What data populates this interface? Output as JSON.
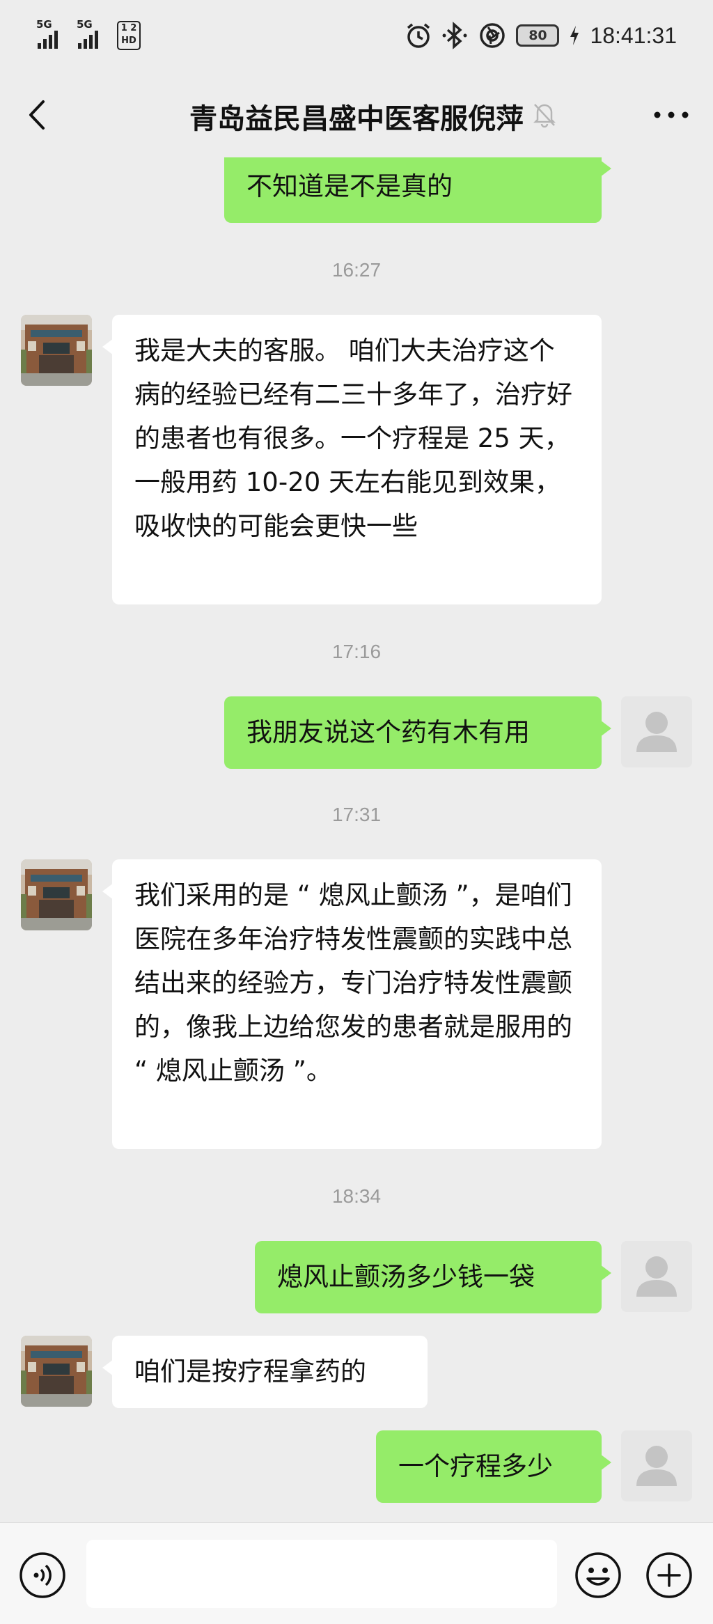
{
  "status_bar": {
    "sim1_label": "5G",
    "sim2_label": "5G",
    "hd_label_top": "1 2",
    "hd_label_bottom": "HD",
    "battery": "80",
    "time": "18:41:31"
  },
  "header": {
    "title": "青岛益民昌盛中医客服倪萍"
  },
  "messages": [
    {
      "side": "me",
      "text": "不知道是不是真的"
    },
    {
      "type": "timestamp",
      "text": "16:27"
    },
    {
      "side": "them",
      "text": "我是大夫的客服。 咱们大夫治疗这个病的经验已经有二三十多年了，治疗好的患者也有很多。一个疗程是 25 天，一般用药 10-20 天左右能见到效果，吸收快的可能会更快一些"
    },
    {
      "type": "timestamp",
      "text": "17:16"
    },
    {
      "side": "me",
      "text": "我朋友说这个药有木有用"
    },
    {
      "type": "timestamp",
      "text": "17:31"
    },
    {
      "side": "them",
      "text": "我们采用的是 “ 熄风止颤汤 ”，是咱们医院在多年治疗特发性震颤的实践中总结出来的经验方，专门治疗特发性震颤的，像我上边给您发的患者就是服用的 “ 熄风止颤汤 ”。"
    },
    {
      "type": "timestamp",
      "text": "18:34"
    },
    {
      "side": "me",
      "text": "熄风止颤汤多少钱一袋"
    },
    {
      "side": "them",
      "text": "咱们是按疗程拿药的"
    },
    {
      "side": "me",
      "text": "一个疗程多少"
    }
  ],
  "colors": {
    "my_bubble": "#95ec69",
    "their_bubble": "#ffffff",
    "background": "#ededed"
  },
  "icons": {
    "back": "chevron-left-icon",
    "mute": "bell-off-icon",
    "more": "more-dots-icon",
    "voice": "voice-icon",
    "emoji": "emoji-icon",
    "plus": "plus-icon"
  }
}
